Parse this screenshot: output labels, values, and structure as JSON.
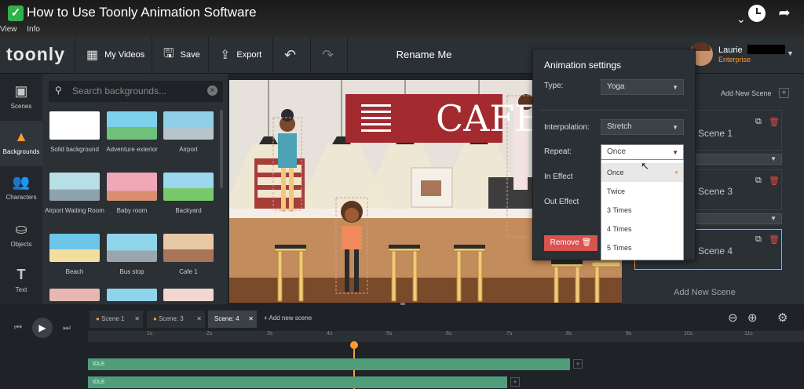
{
  "video": {
    "title": "How to Use Toonly Animation Software",
    "menu": [
      "View",
      "Info"
    ]
  },
  "header": {
    "logo": "toonly",
    "my_videos": "My Videos",
    "save": "Save",
    "export": "Export",
    "project_name": "Rename Me",
    "user_name": "Laurie",
    "user_plan": "Enterprise"
  },
  "sidebar": [
    {
      "label": "Scenes",
      "icon": "scenes-icon"
    },
    {
      "label": "Backgrounds",
      "icon": "backgrounds-icon"
    },
    {
      "label": "Characters",
      "icon": "characters-icon"
    },
    {
      "label": "Objects",
      "icon": "objects-icon"
    },
    {
      "label": "Text",
      "icon": "text-icon"
    }
  ],
  "backgrounds": {
    "search_placeholder": "Search backgrounds...",
    "items": [
      {
        "label": "Solid background",
        "color": "#ffffff"
      },
      {
        "label": "Adventure exterior",
        "color": "#6fc07a"
      },
      {
        "label": "Airport",
        "color": "#8fd0e8"
      },
      {
        "label": "Airport Waiting Room",
        "color": "#b9dfe6"
      },
      {
        "label": "Baby room",
        "color": "#f0a7b7"
      },
      {
        "label": "Backyard",
        "color": "#78c86c"
      },
      {
        "label": "Beach",
        "color": "#6cc6e8"
      },
      {
        "label": "Bus stop",
        "color": "#8fd4ea"
      },
      {
        "label": "Cafe 1",
        "color": "#e7c9a8"
      }
    ]
  },
  "canvas": {
    "sign_text": "CAFE"
  },
  "scenes_panel": {
    "add_new_top": "Add New Scene",
    "scenes": [
      "Scene 1",
      "Scene 3",
      "Scene 4"
    ],
    "add_new_bottom": "Add New Scene"
  },
  "animation_settings": {
    "title": "Animation settings",
    "type_label": "Type:",
    "type_value": "Yoga",
    "interpolation_label": "Interpolation:",
    "interpolation_value": "Stretch",
    "repeat_label": "Repeat:",
    "repeat_value": "Once",
    "in_effect_label": "In Effect",
    "out_effect_label": "Out Effect",
    "remove_label": "Remove",
    "repeat_options": [
      "Once",
      "Twice",
      "3 Times",
      "4 Times",
      "5 Times"
    ]
  },
  "timeline": {
    "tabs": [
      "Scene 1",
      "Scene: 3",
      "Scene: 4"
    ],
    "add_scene": "Add new scene",
    "ticks": [
      "1s",
      "2s",
      "3s",
      "4s",
      "5s",
      "6s",
      "7s",
      "8s",
      "9s",
      "10s",
      "11s"
    ],
    "tracks": [
      {
        "label": "IDLE"
      },
      {
        "label": "IDLE"
      }
    ]
  },
  "colors": {
    "accent": "#ff9b2f",
    "track": "#4f9d7a",
    "remove": "#d9534f",
    "cafe_sign": "#a32a2f"
  }
}
